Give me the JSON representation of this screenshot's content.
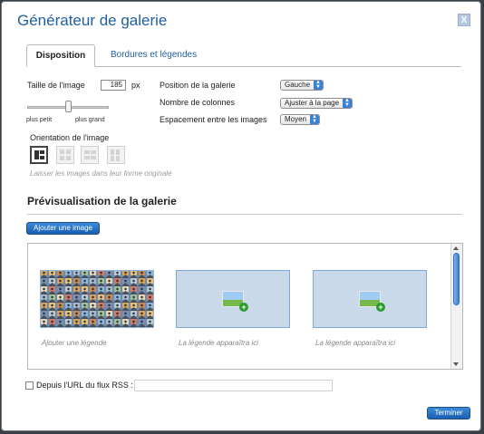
{
  "dialog": {
    "title": "Générateur de galerie",
    "close_label": "X"
  },
  "tabs": [
    {
      "label": "Disposition",
      "active": true
    },
    {
      "label": "Bordures et légendes",
      "active": false
    }
  ],
  "image_size": {
    "label": "Taille de l'image",
    "value": "185",
    "unit": "px",
    "min_label": "plus petit",
    "max_label": "plus grand"
  },
  "orientation": {
    "label": "Orientation de l'image",
    "hint": "Laisser les images dans leur forme originale"
  },
  "options": {
    "position": {
      "label": "Position de la galerie",
      "value": "Gauche"
    },
    "columns": {
      "label": "Nombre de colonnes",
      "value": "Ajuster à la page"
    },
    "spacing": {
      "label": "Espacement entre les images",
      "value": "Moyen"
    }
  },
  "preview": {
    "title": "Prévisualisation de la galerie",
    "add_image_label": "Ajouter une image",
    "captions": [
      "Ajouter une légende",
      "La légende apparaîtra ici",
      "La légende apparaîtra ici"
    ]
  },
  "rss": {
    "label": "Depuis l'URL du flux RSS :",
    "value": ""
  },
  "footer": {
    "done_label": "Terminer"
  },
  "colors": {
    "accent": "#1f5f9f",
    "button": "#2a74c8"
  }
}
